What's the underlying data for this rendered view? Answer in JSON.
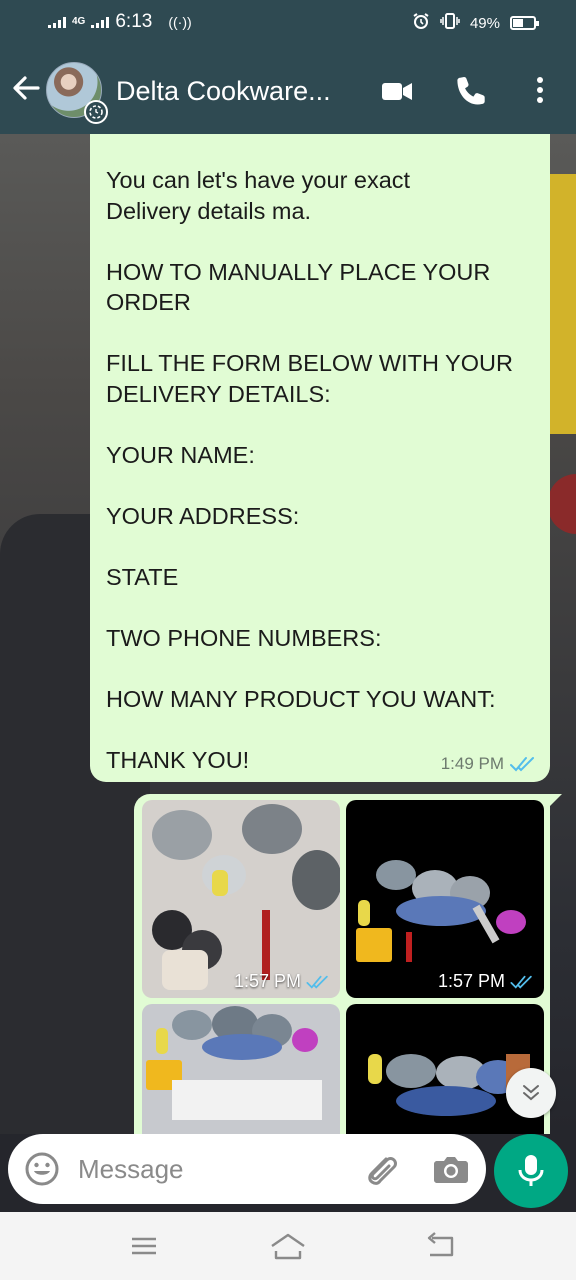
{
  "status_bar": {
    "time": "6:13",
    "network": "4G",
    "battery": "49%"
  },
  "header": {
    "chat_name": "Delta Cookware...",
    "icons": [
      "back-arrow-icon",
      "video-call-icon",
      "phone-icon",
      "more-vert-icon"
    ]
  },
  "messages": [
    {
      "type": "text",
      "text": " You can let's have your exact\nDelivery details ma.\n\nHOW TO MANUALLY PLACE YOUR\nORDER\n\nFILL THE FORM BELOW WITH YOUR\nDELIVERY DETAILS:\n\nYOUR NAME:\n\nYOUR ADDRESS:\n\nSTATE\n\nTWO PHONE NUMBERS:\n\nHOW MANY PRODUCT YOU WANT:\n\nTHANK YOU!",
      "time": "1:49 PM",
      "status": "read"
    },
    {
      "type": "image_album",
      "images": [
        {
          "time": "1:57 PM",
          "status": "read"
        },
        {
          "time": "1:57 PM",
          "status": "read"
        },
        {
          "time": "",
          "status": ""
        },
        {
          "time": "",
          "status": ""
        }
      ]
    }
  ],
  "composer": {
    "placeholder": "Message",
    "icons": [
      "emoji-icon",
      "attach-icon",
      "camera-icon",
      "mic-icon"
    ]
  },
  "colors": {
    "header": "#2f4a52",
    "outgoing_bubble": "#e1fcd4",
    "read_tick": "#53bdeb",
    "accent": "#00a884"
  }
}
